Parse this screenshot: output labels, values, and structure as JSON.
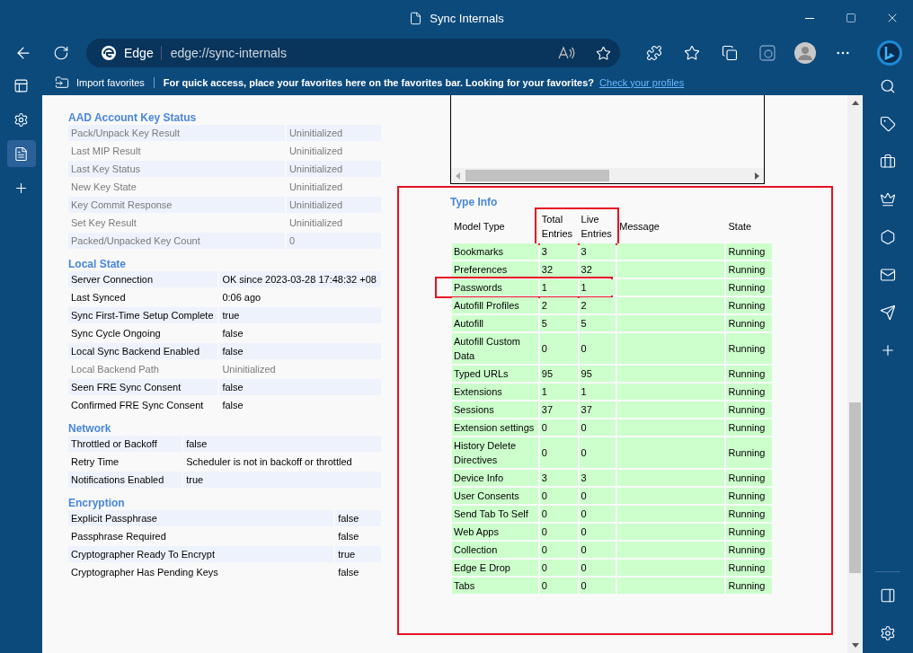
{
  "window": {
    "title": "Sync Internals"
  },
  "toolbar": {
    "brand": "Edge",
    "url": "edge://sync-internals"
  },
  "favorites_bar": {
    "import": "Import favorites",
    "message": "For quick access, place your favorites here on the favorites bar. Looking for your favorites?",
    "link": "Check your profiles"
  },
  "sections": [
    {
      "title": "AAD Account Key Status",
      "rows": [
        {
          "label": "Pack/Unpack Key Result",
          "value": "Uninitialized",
          "greyed": true
        },
        {
          "label": "Last MIP Result",
          "value": "Uninitialized",
          "greyed": true
        },
        {
          "label": "Last Key Status",
          "value": "Uninitialized",
          "greyed": true
        },
        {
          "label": "New Key State",
          "value": "Uninitialized",
          "greyed": true
        },
        {
          "label": "Key Commit Response",
          "value": "Uninitialized",
          "greyed": true
        },
        {
          "label": "Set Key Result",
          "value": "Uninitialized",
          "greyed": true
        },
        {
          "label": "Packed/Unpacked Key Count",
          "value": "0",
          "greyed": true
        }
      ]
    },
    {
      "title": "Local State",
      "rows": [
        {
          "label": "Server Connection",
          "value": "OK since 2023-03-28 17:48:32 +08",
          "greyed": false
        },
        {
          "label": "Last Synced",
          "value": "0:06 ago",
          "greyed": false
        },
        {
          "label": "Sync First-Time Setup Complete",
          "value": "true",
          "greyed": false
        },
        {
          "label": "Sync Cycle Ongoing",
          "value": "false",
          "greyed": false
        },
        {
          "label": "Local Sync Backend Enabled",
          "value": "false",
          "greyed": false
        },
        {
          "label": "Local Backend Path",
          "value": "Uninitialized",
          "greyed": true
        },
        {
          "label": "Seen FRE Sync Consent",
          "value": "false",
          "greyed": false
        },
        {
          "label": "Confirmed FRE Sync Consent",
          "value": "false",
          "greyed": false
        }
      ]
    },
    {
      "title": "Network",
      "rows": [
        {
          "label": "Throttled or Backoff",
          "value": "false",
          "greyed": false
        },
        {
          "label": "Retry Time",
          "value": "Scheduler is not in backoff or throttled",
          "greyed": false
        },
        {
          "label": "Notifications Enabled",
          "value": "true",
          "greyed": false
        }
      ]
    },
    {
      "title": "Encryption",
      "rows": [
        {
          "label": "Explicit Passphrase",
          "value": "false",
          "greyed": false
        },
        {
          "label": "Passphrase Required",
          "value": "false",
          "greyed": false
        },
        {
          "label": "Cryptographer Ready To Encrypt",
          "value": "true",
          "greyed": false
        },
        {
          "label": "Cryptographer Has Pending Keys",
          "value": "false",
          "greyed": false
        }
      ]
    }
  ],
  "type_info": {
    "title": "Type Info",
    "highlighted": true,
    "columns": [
      {
        "label": "Model Type",
        "highlighted": false
      },
      {
        "label": "Total Entries",
        "highlighted": true
      },
      {
        "label": "Live Entries",
        "highlighted": true
      },
      {
        "label": "Message",
        "highlighted": false
      },
      {
        "label": "State",
        "highlighted": false
      }
    ],
    "rows": [
      {
        "model": "Bookmarks",
        "total": "3",
        "live": "3",
        "state": "Running",
        "highlighted": false
      },
      {
        "model": "Preferences",
        "total": "32",
        "live": "32",
        "state": "Running",
        "highlighted": false
      },
      {
        "model": "Passwords",
        "total": "1",
        "live": "1",
        "state": "Running",
        "highlighted": true
      },
      {
        "model": "Autofill Profiles",
        "total": "2",
        "live": "2",
        "state": "Running",
        "highlighted": false
      },
      {
        "model": "Autofill",
        "total": "5",
        "live": "5",
        "state": "Running",
        "highlighted": false
      },
      {
        "model": "Autofill Custom Data",
        "total": "0",
        "live": "0",
        "state": "Running",
        "highlighted": false
      },
      {
        "model": "Typed URLs",
        "total": "95",
        "live": "95",
        "state": "Running",
        "highlighted": false
      },
      {
        "model": "Extensions",
        "total": "1",
        "live": "1",
        "state": "Running",
        "highlighted": false
      },
      {
        "model": "Sessions",
        "total": "37",
        "live": "37",
        "state": "Running",
        "highlighted": false
      },
      {
        "model": "Extension settings",
        "total": "0",
        "live": "0",
        "state": "Running",
        "highlighted": false
      },
      {
        "model": "History Delete Directives",
        "total": "0",
        "live": "0",
        "state": "Running",
        "highlighted": false
      },
      {
        "model": "Device Info",
        "total": "3",
        "live": "3",
        "state": "Running",
        "highlighted": false
      },
      {
        "model": "User Consents",
        "total": "0",
        "live": "0",
        "state": "Running",
        "highlighted": false
      },
      {
        "model": "Send Tab To Self",
        "total": "0",
        "live": "0",
        "state": "Running",
        "highlighted": false
      },
      {
        "model": "Web Apps",
        "total": "0",
        "live": "0",
        "state": "Running",
        "highlighted": false
      },
      {
        "model": "Collection",
        "total": "0",
        "live": "0",
        "state": "Running",
        "highlighted": false
      },
      {
        "model": "Edge E Drop",
        "total": "0",
        "live": "0",
        "state": "Running",
        "highlighted": false
      },
      {
        "model": "Tabs",
        "total": "0",
        "live": "0",
        "state": "Running",
        "highlighted": false
      }
    ]
  }
}
